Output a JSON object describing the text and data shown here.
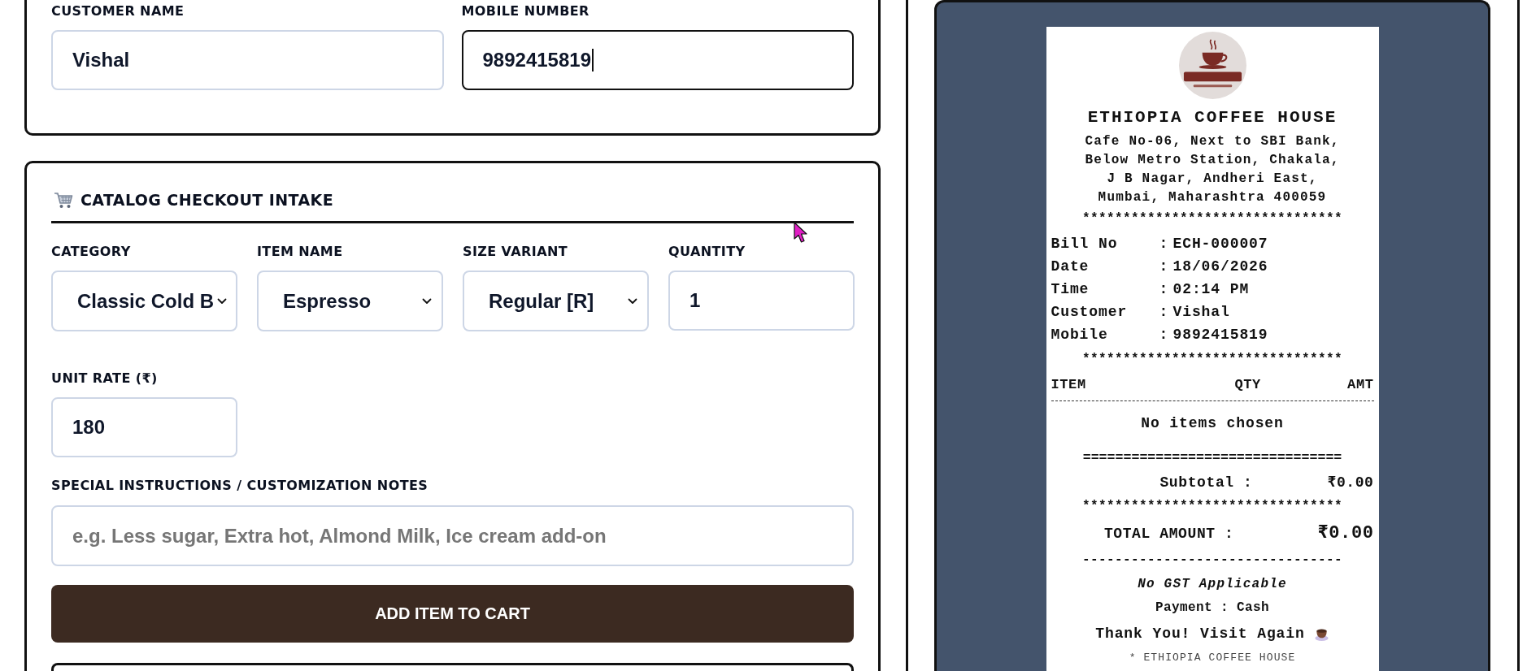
{
  "customer_section": {
    "fields": [
      {
        "label": "CUSTOMER NAME",
        "value": "Vishal",
        "focused": false
      },
      {
        "label": "MOBILE NUMBER",
        "value": "9892415819",
        "focused": true
      }
    ]
  },
  "catalog_section": {
    "title": "CATALOG CHECKOUT INTAKE",
    "fields": [
      {
        "kind": "select",
        "label": "CATEGORY",
        "value": "Classic Cold B"
      },
      {
        "kind": "select",
        "label": "ITEM NAME",
        "value": "Espresso"
      },
      {
        "kind": "select",
        "label": "SIZE VARIANT",
        "value": "Regular [R]"
      },
      {
        "kind": "input",
        "label": "QUANTITY",
        "value": "1"
      },
      {
        "kind": "input",
        "label": "UNIT RATE (₹)",
        "value": "180"
      }
    ],
    "notes": {
      "label": "SPECIAL INSTRUCTIONS / CUSTOMIZATION NOTES",
      "placeholder": "e.g. Less sugar, Extra hot, Almond Milk, Ice cream add-on"
    },
    "add_button": "ADD ITEM TO CART"
  },
  "receipt": {
    "shop_name": "ETHIOPIA COFFEE HOUSE",
    "address_lines": [
      "Cafe No-06, Next to SBI Bank,",
      "Below Metro Station, Chakala,",
      "J B Nagar, Andheri East,",
      "Mumbai, Maharashtra 400059"
    ],
    "separator_1": "********************************",
    "details": [
      {
        "label": "Bill No",
        "separator": ":",
        "value": "ECH-000007"
      },
      {
        "label": "Date",
        "separator": ":",
        "value": "18/06/2026"
      },
      {
        "label": "Time",
        "separator": ":",
        "value": "02:14 PM"
      },
      {
        "label": "Customer",
        "separator": ":",
        "value": "Vishal"
      },
      {
        "label": "Mobile",
        "separator": ":",
        "value": "9892415819"
      }
    ],
    "separator_2": "********************************",
    "columns": [
      "ITEM",
      "QTY",
      "AMT"
    ],
    "empty_message": "No items chosen",
    "double_rule": "================================",
    "subtotal": {
      "label": "Subtotal :",
      "value": "₹0.00"
    },
    "separator_3": "********************************",
    "total": {
      "label": "TOTAL AMOUNT :",
      "value": "₹0.00"
    },
    "dash_rule": "--------------------------------",
    "tax_note": "No GST Applicable",
    "payment": "Payment : Cash",
    "thanks": "Thank You! Visit Again",
    "footer": "* ETHIOPIA COFFEE HOUSE"
  }
}
